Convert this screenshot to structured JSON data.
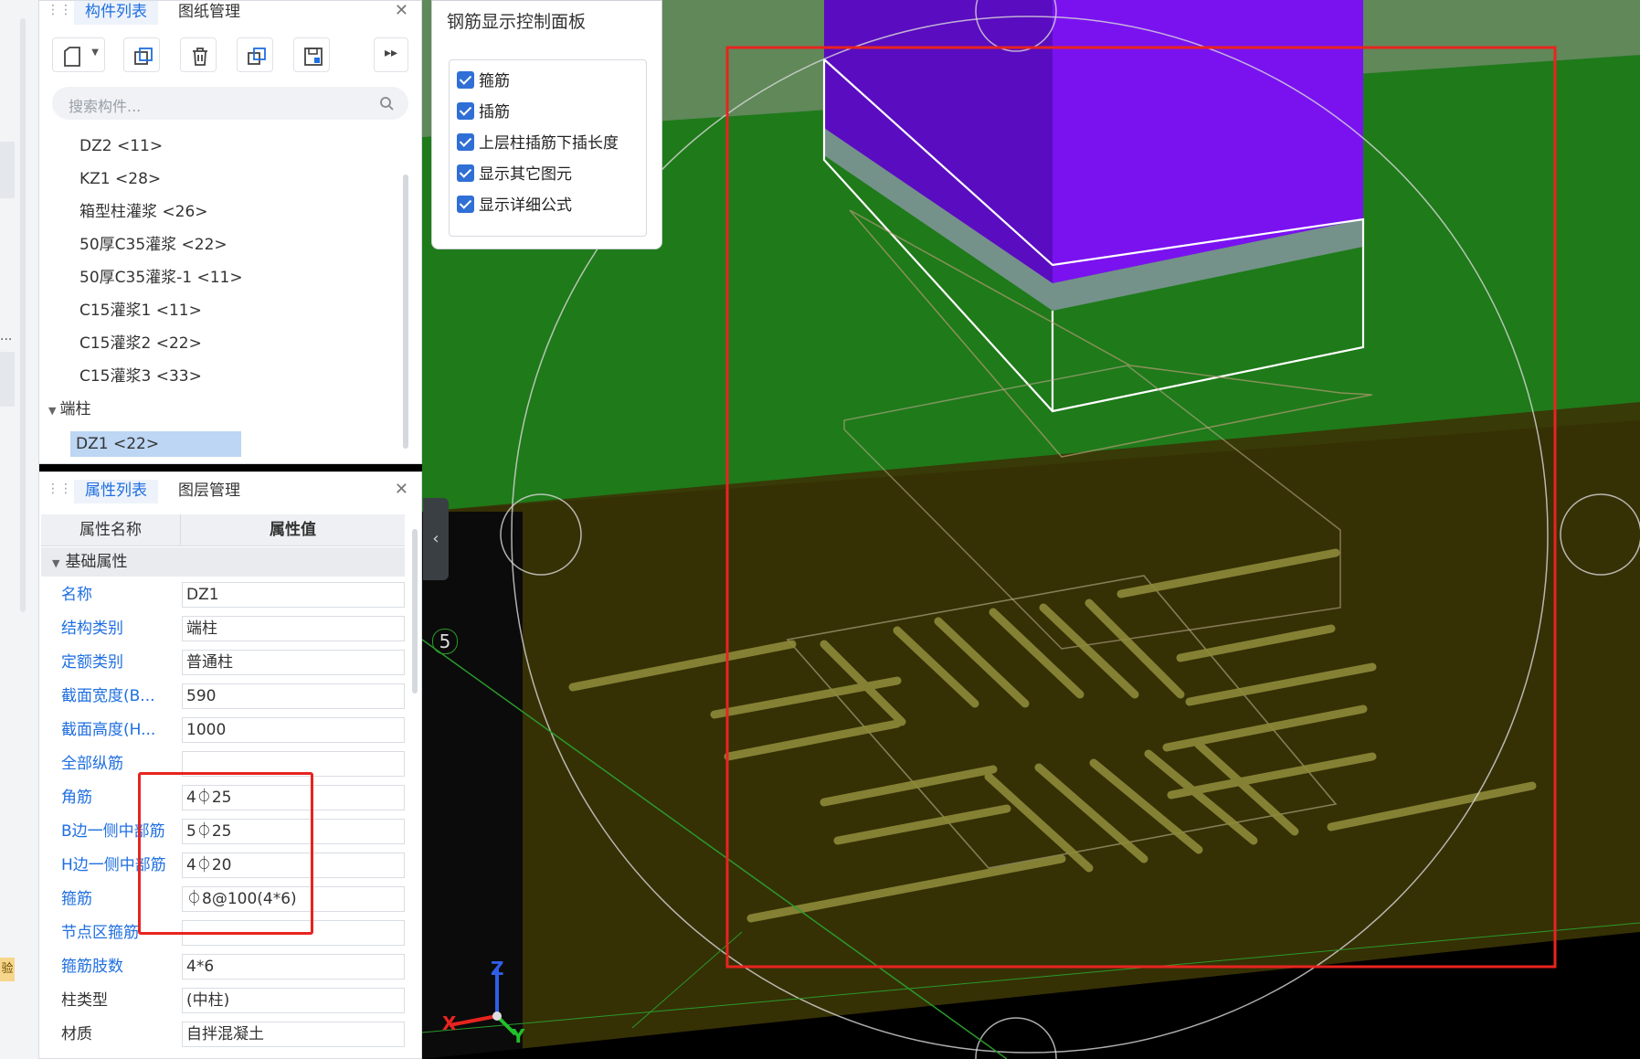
{
  "component_panel": {
    "tabs": [
      "构件列表",
      "图纸管理"
    ],
    "search_placeholder": "搜索构件...",
    "items": [
      "DZ2 <11>",
      "KZ1 <28>",
      "箱型柱灌浆 <26>",
      "50厚C35灌浆 <22>",
      "50厚C35灌浆-1 <11>",
      "C15灌浆1 <11>",
      "C15灌浆2 <22>",
      "C15灌浆3 <33>"
    ],
    "group": "端柱",
    "selected_item": "DZ1 <22>"
  },
  "property_panel": {
    "tabs": [
      "属性列表",
      "图层管理"
    ],
    "col_name": "属性名称",
    "col_value": "属性值",
    "section": "基础属性",
    "rows": [
      {
        "name": "名称",
        "value": "DZ1"
      },
      {
        "name": "结构类别",
        "value": "端柱"
      },
      {
        "name": "定额类别",
        "value": "普通柱"
      },
      {
        "name": "截面宽度(B...",
        "value": "590"
      },
      {
        "name": "截面高度(H...",
        "value": "1000"
      },
      {
        "name": "全部纵筋",
        "value": ""
      },
      {
        "name": "角筋",
        "value": "4⏀25"
      },
      {
        "name": "B边一侧中部筋",
        "value": "5⏀25"
      },
      {
        "name": "H边一侧中部筋",
        "value": "4⏀20"
      },
      {
        "name": "箍筋",
        "value": "⏀8@100(4*6)"
      },
      {
        "name": "节点区箍筋",
        "value": ""
      },
      {
        "name": "箍筋肢数",
        "value": "4*6"
      },
      {
        "name": "柱类型",
        "value": "(中柱)"
      },
      {
        "name": "材质",
        "value": "自拌混凝土"
      }
    ]
  },
  "rebar_panel": {
    "title": "钢筋显示控制面板",
    "options": [
      {
        "label": "箍筋",
        "checked": true
      },
      {
        "label": "插筋",
        "checked": true
      },
      {
        "label": "上层柱插筋下插长度",
        "checked": true
      },
      {
        "label": "显示其它图元",
        "checked": true
      },
      {
        "label": "显示详细公式",
        "checked": true
      }
    ]
  },
  "viewport": {
    "axis_label": "5",
    "axes": {
      "x": "X",
      "y": "Y",
      "z": "Z"
    }
  },
  "left_strip": {
    "dots": "...",
    "badge": "验"
  },
  "colors": {
    "accent": "#1f6fe0",
    "column": "#7a12f0",
    "highlight": "#e8241f",
    "ground": "#1f7a1a"
  }
}
